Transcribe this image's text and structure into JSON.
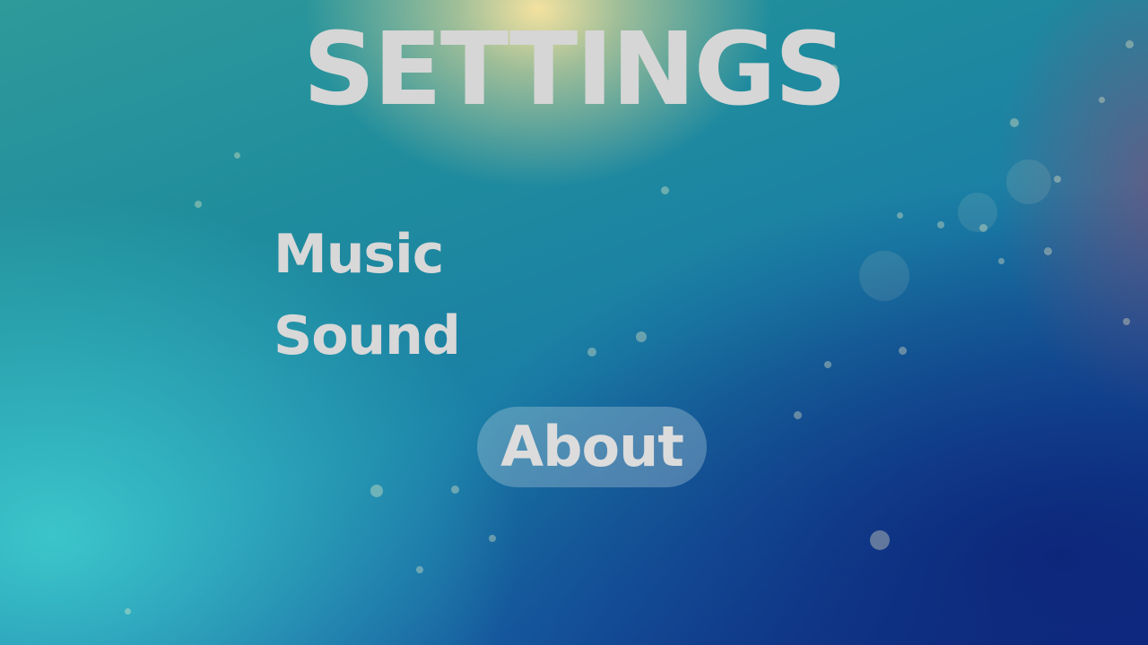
{
  "screen": {
    "title": "SETTINGS"
  },
  "menu": {
    "music_label": "Music",
    "sound_label": "Sound"
  },
  "about_button": {
    "label": "About"
  },
  "colors": {
    "text": "#d8d8d8",
    "background_top": "#2f9a9a",
    "background_bottom": "#0f2f88",
    "glow": "#f0dc96"
  }
}
